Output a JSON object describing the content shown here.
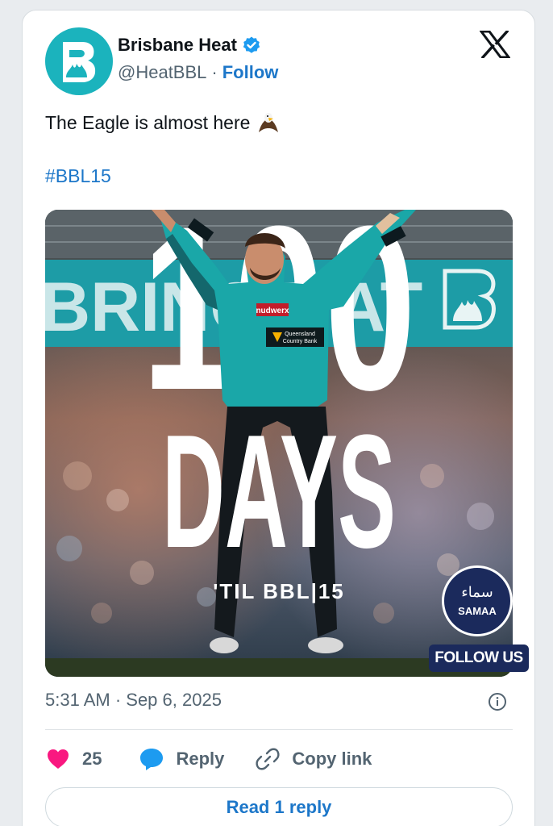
{
  "account": {
    "name": "Brisbane Heat",
    "handle": "@HeatBBL",
    "separator": "·",
    "follow_label": "Follow",
    "verified": true
  },
  "platform_icon": "x-logo-icon",
  "tweet": {
    "text": "The Eagle is almost here",
    "emoji": "eagle-emoji",
    "hashtag": "#BBL15"
  },
  "media": {
    "top_text": "100",
    "big_text": "DAYS",
    "caption": "'TIL BBL|15",
    "sponsor_badge": "Queensland Country Bank",
    "jersey_logo": "nudwerx",
    "banner_text": "BRINGT",
    "banner_text_right": "AT",
    "samaa_badge_urdu": "سماء",
    "samaa_badge_label": "SAMAA",
    "follow_us_label": "FOLLOW US"
  },
  "meta": {
    "timestamp": "5:31 AM · Sep 6, 2025"
  },
  "actions": {
    "likes_count": "25",
    "reply_label": "Reply",
    "copy_link_label": "Copy link"
  },
  "read_reply_label": "Read 1 reply",
  "colors": {
    "accent": "#1d77c9",
    "heat_teal": "#1bb3bd",
    "like_pink": "#f91880",
    "text_primary": "#0f1419",
    "text_secondary": "#536471"
  }
}
